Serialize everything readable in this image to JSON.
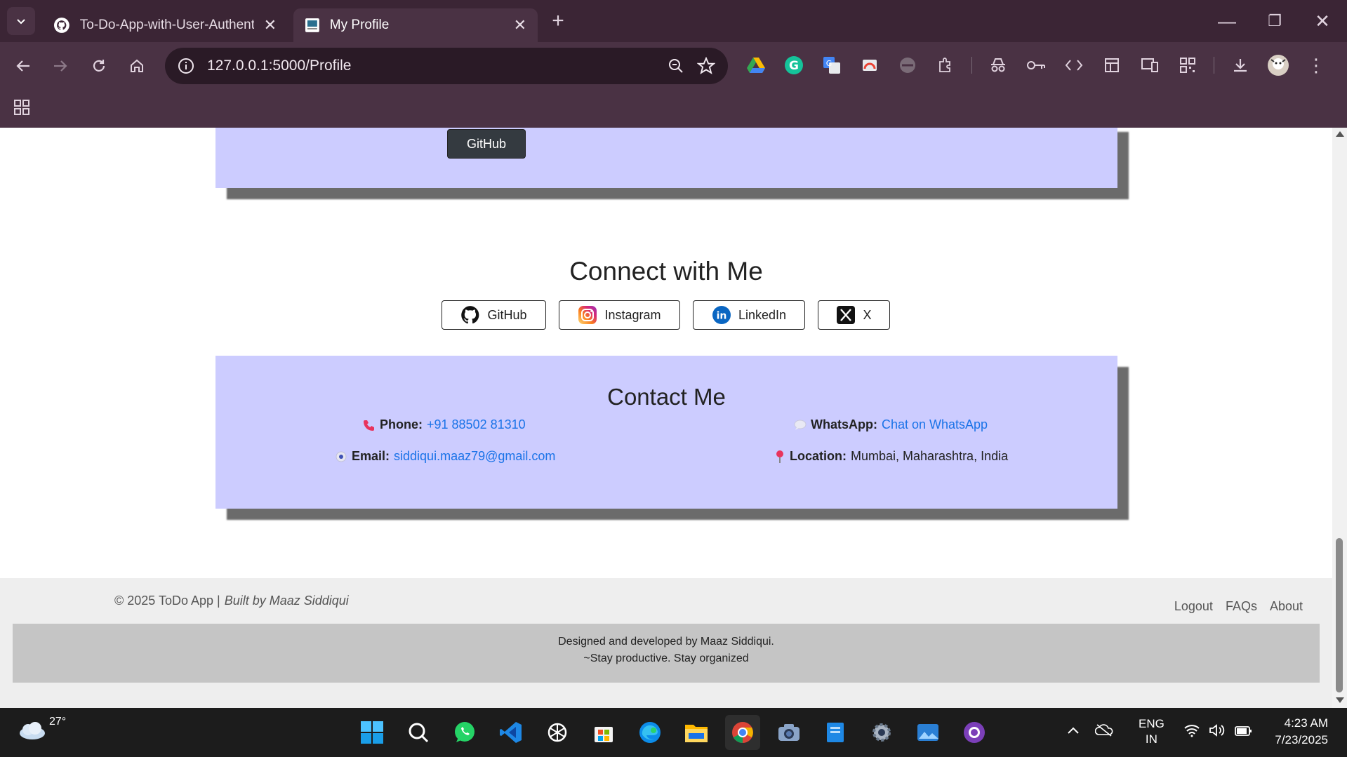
{
  "browser": {
    "tabs": [
      {
        "title": "To-Do-App-with-User-Authenti",
        "active": false
      },
      {
        "title": "My Profile",
        "active": true
      }
    ],
    "new_tab": "+",
    "address": "127.0.0.1:5000/Profile",
    "window": {
      "minimize": "—",
      "restore": "❐",
      "close": "✕"
    }
  },
  "page": {
    "profile_card": {
      "github_button": "GitHub"
    },
    "connect": {
      "title": "Connect with Me",
      "links": [
        {
          "label": "GitHub",
          "icon": "github-icon"
        },
        {
          "label": "Instagram",
          "icon": "instagram-icon"
        },
        {
          "label": "LinkedIn",
          "icon": "linkedin-icon"
        },
        {
          "label": "X",
          "icon": "x-icon"
        }
      ]
    },
    "contact": {
      "title": "Contact Me",
      "phone_label": "Phone:",
      "phone_value": "+91 88502 81310",
      "whatsapp_label": "WhatsApp:",
      "whatsapp_value": "Chat on WhatsApp",
      "email_label": "Email:",
      "email_value": "siddiqui.maaz79@gmail.com",
      "location_label": "Location:",
      "location_value": "Mumbai, Maharashtra, India"
    },
    "footer": {
      "copyright": "© 2025 ToDo App |",
      "built_by": "Built by Maaz Siddiqui",
      "links": [
        "Logout",
        "FAQs",
        "About"
      ],
      "credit_line1": "Designed and developed by Maaz Siddiqui.",
      "credit_line2": "~Stay productive. Stay organized"
    }
  },
  "taskbar": {
    "weather_temp": "27°",
    "lang_line1": "ENG",
    "lang_line2": "IN",
    "time": "4:23 AM",
    "date": "7/23/2025"
  },
  "colors": {
    "card_bg": "#ccccff",
    "link": "#1a73e8",
    "chrome_dark": "#3b2535",
    "chrome": "#4a3244"
  }
}
